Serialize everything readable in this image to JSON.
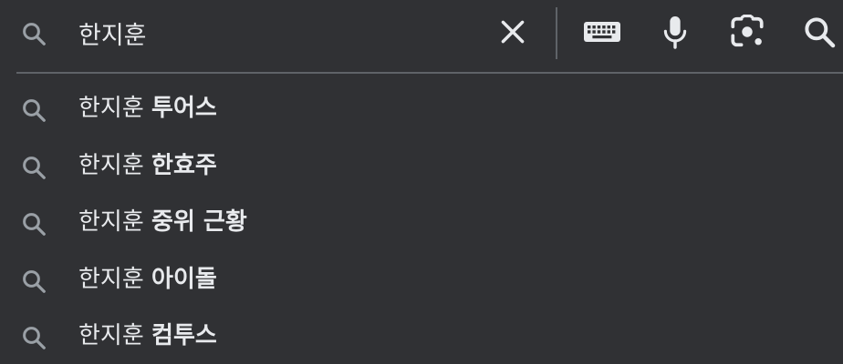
{
  "search": {
    "value": "한지훈",
    "icon": "search-icon"
  },
  "toolbar": {
    "clear_icon": "close-icon",
    "keyboard_icon": "keyboard-icon",
    "voice_icon": "microphone-icon",
    "lens_icon": "camera-lens-icon",
    "search_icon": "search-icon"
  },
  "suggestions": [
    {
      "query": "한지훈",
      "completion": "투어스"
    },
    {
      "query": "한지훈",
      "completion": "한효주"
    },
    {
      "query": "한지훈",
      "completion": "중위 근황"
    },
    {
      "query": "한지훈",
      "completion": "아이돌"
    },
    {
      "query": "한지훈",
      "completion": "컴투스"
    }
  ],
  "colors": {
    "background": "#303134",
    "text": "#e8eaed",
    "icon": "#9aa0a6",
    "toolbar_icon": "#e8eaed",
    "divider": "#5f6368"
  }
}
